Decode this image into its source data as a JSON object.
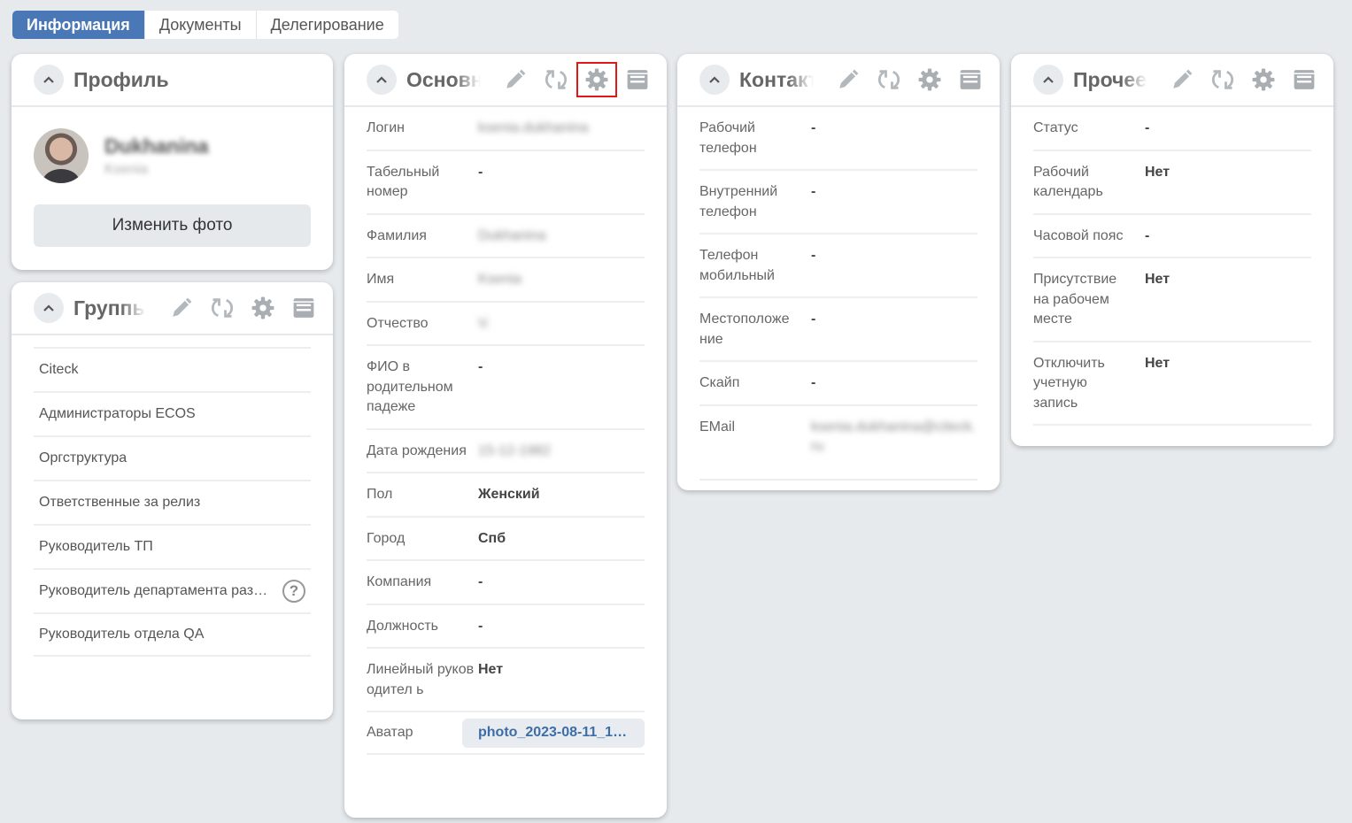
{
  "tabs": [
    {
      "label": "Информация",
      "active": true
    },
    {
      "label": "Документы",
      "active": false
    },
    {
      "label": "Делегирование",
      "active": false
    }
  ],
  "profile": {
    "title": "Профиль",
    "surname": "Dukhanina",
    "firstname": "Ksenia",
    "change_photo_label": "Изменить фото"
  },
  "groups": {
    "title": "Группы",
    "items": [
      "Citeck",
      "Администраторы ECOS",
      "Оргструктура",
      "Ответственные за релиз",
      "Руководитель ТП",
      "Руководитель департамента разр...",
      "Руководитель отдела QA"
    ]
  },
  "main": {
    "title": "Основная информация",
    "rows": [
      {
        "label": "Логин",
        "value": "ksenia.dukhanina"
      },
      {
        "label": "Табельный номер",
        "value": "-"
      },
      {
        "label": "Фамилия",
        "value": "Dukhanina"
      },
      {
        "label": "Имя",
        "value": "Ksenia"
      },
      {
        "label": "Отчество",
        "value": "V."
      },
      {
        "label": "ФИО в родительном падеже",
        "value": "-"
      },
      {
        "label": "Дата рождения",
        "value": "15-12-1982"
      },
      {
        "label": "Пол",
        "value": "Женский"
      },
      {
        "label": "Город",
        "value": "Спб"
      },
      {
        "label": "Компания",
        "value": "-"
      },
      {
        "label": "Должность",
        "value": "-"
      },
      {
        "label": "Линейный руководител ь",
        "value": "Нет"
      },
      {
        "label": "Аватар",
        "value": "photo_2023-08-11_10-..."
      }
    ]
  },
  "contacts": {
    "title": "Контакты",
    "rows": [
      {
        "label": "Рабочий телефон",
        "value": "-"
      },
      {
        "label": "Внутренний телефон",
        "value": "-"
      },
      {
        "label": "Телефон мобильный",
        "value": "-"
      },
      {
        "label": "Местоположе ние",
        "value": "-"
      },
      {
        "label": "Скайп",
        "value": "-"
      },
      {
        "label": "EMail",
        "value": "ksenia.dukhanina@citeck.ru"
      }
    ]
  },
  "other": {
    "title": "Прочее",
    "rows": [
      {
        "label": "Статус",
        "value": "-"
      },
      {
        "label": "Рабочий календарь",
        "value": "Нет"
      },
      {
        "label": "Часовой пояс",
        "value": "-"
      },
      {
        "label": "Присутствие на рабочем месте",
        "value": "Нет"
      },
      {
        "label": "Отключить учетную запись",
        "value": "Нет"
      }
    ]
  },
  "icons": {
    "collapse": "chevron-up-icon",
    "edit": "pencil-icon",
    "refresh": "refresh-icon",
    "settings": "gear-icon",
    "menu": "list-icon",
    "help": "question-icon"
  },
  "colors": {
    "accent": "#4a78b6",
    "highlight": "#e01818",
    "link": "#3d6da8"
  }
}
